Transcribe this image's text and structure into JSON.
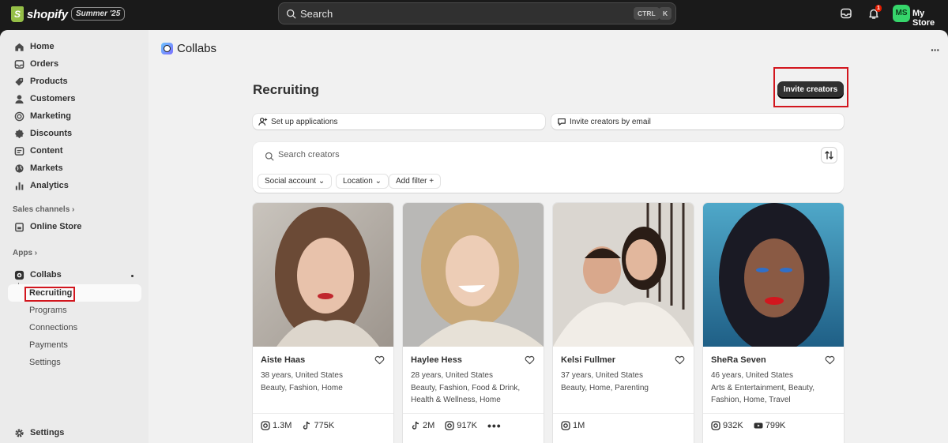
{
  "topbar": {
    "brand": "shopify",
    "edition": "Summer '25",
    "search_placeholder": "Search",
    "shortcut_ctrl": "CTRL",
    "shortcut_key": "K",
    "notification_count": "1",
    "avatar_initials": "MS",
    "store_name": "My Store"
  },
  "sidebar": {
    "items": [
      {
        "label": "Home",
        "icon": "home-icon"
      },
      {
        "label": "Orders",
        "icon": "orders-icon"
      },
      {
        "label": "Products",
        "icon": "tag-icon"
      },
      {
        "label": "Customers",
        "icon": "person-icon"
      },
      {
        "label": "Marketing",
        "icon": "target-icon"
      },
      {
        "label": "Discounts",
        "icon": "discount-icon"
      },
      {
        "label": "Content",
        "icon": "content-icon"
      },
      {
        "label": "Markets",
        "icon": "globe-icon"
      },
      {
        "label": "Analytics",
        "icon": "chart-icon"
      }
    ],
    "sales_channels_label": "Sales channels",
    "online_store": "Online Store",
    "apps_label": "Apps",
    "collabs": "Collabs",
    "collabs_sub": [
      "Recruiting",
      "Programs",
      "Connections",
      "Payments",
      "Settings"
    ],
    "settings": "Settings"
  },
  "header": {
    "app_title": "Collabs",
    "page_title": "Recruiting",
    "invite_button": "Invite creators",
    "setup_applications": "Set up applications",
    "invite_by_email": "Invite creators by email"
  },
  "filters": {
    "search_placeholder": "Search creators",
    "social_account": "Social account",
    "location": "Location",
    "add_filter": "Add filter"
  },
  "creators": [
    {
      "name": "Aiste Haas",
      "age_location": "38 years, United States",
      "categories": "Beauty, Fashion, Home",
      "stats": [
        {
          "platform": "instagram-icon",
          "value": "1.3M"
        },
        {
          "platform": "tiktok-icon",
          "value": "775K"
        }
      ]
    },
    {
      "name": "Haylee Hess",
      "age_location": "28 years, United States",
      "categories": "Beauty, Fashion, Food & Drink, Health & Wellness, Home",
      "stats": [
        {
          "platform": "tiktok-icon",
          "value": "2M"
        },
        {
          "platform": "instagram-icon",
          "value": "917K"
        }
      ]
    },
    {
      "name": "Kelsi Fullmer",
      "age_location": "37 years, United States",
      "categories": "Beauty, Home, Parenting",
      "stats": [
        {
          "platform": "instagram-icon",
          "value": "1M"
        }
      ]
    },
    {
      "name": "ShеRa Seven",
      "age_location": "46 years, United States",
      "categories": "Arts & Entertainment, Beauty, Fashion, Home, Travel",
      "stats": [
        {
          "platform": "instagram-icon",
          "value": "932K"
        },
        {
          "platform": "youtube-icon",
          "value": "799K"
        }
      ]
    }
  ],
  "colors": {
    "topbar": "#1a1a1a",
    "primary_button": "#303030",
    "highlight": "#d2161e",
    "avatar": "#36d66b"
  }
}
